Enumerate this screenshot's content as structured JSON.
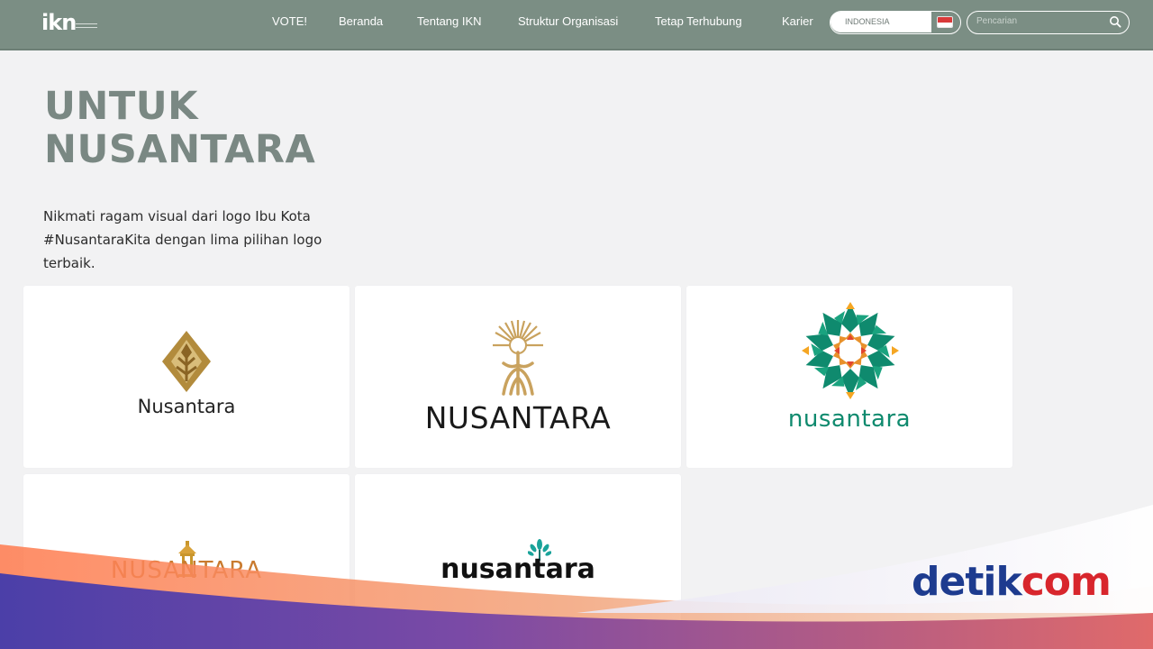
{
  "nav": {
    "logo": "ikn",
    "items": [
      "VOTE!",
      "Beranda",
      "Tentang IKN",
      "Struktur Organisasi",
      "Tetap Terhubung",
      "Karier"
    ],
    "language": "INDONESIA",
    "search_placeholder": "Pencarian"
  },
  "hero": {
    "title_line1": "UNTUK",
    "title_line2": "NUSANTARA",
    "description": "Nikmati ragam visual dari logo Ibu Kota #NusantaraKita dengan lima pilihan logo terbaik."
  },
  "logos": [
    {
      "wordmark": "Nusantara",
      "icon": "gold-diamond-tree-icon"
    },
    {
      "wordmark": "NUSANTARA",
      "icon": "gold-sun-tree-icon"
    },
    {
      "wordmark": "nusantara",
      "icon": "green-orange-flower-icon"
    },
    {
      "wordmark": "NUSANTARA",
      "icon": "gold-tower-icon"
    },
    {
      "wordmark": "nusantara",
      "icon": "teal-plant-icon"
    }
  ],
  "watermark": {
    "part1": "detik",
    "part2": "com"
  },
  "colors": {
    "nav_bg": "#7b8e84",
    "title_gray": "#7a8883",
    "gold": "#b28b3c",
    "green": "#0f8a6e",
    "orange": "#e8912b",
    "detik_blue": "#1d3b8f",
    "detik_red": "#d8262d"
  }
}
